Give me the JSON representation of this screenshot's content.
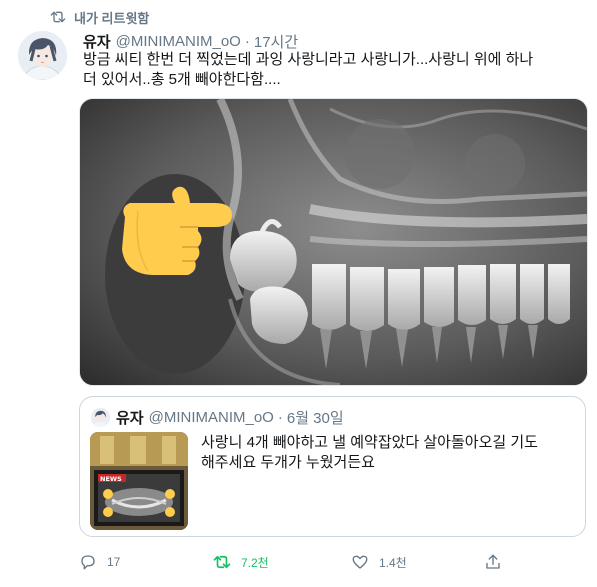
{
  "retweet_context": {
    "label": "내가 리트윗함",
    "icon": "retweet-icon"
  },
  "tweet": {
    "author_name": "유자",
    "author_handle": "@MINIMANIM_oO",
    "separator": "·",
    "time": "17시간",
    "text": "방금 씨티 한번 더 찍었는데 과잉 사랑니라고 사랑니가...사랑니 위에 하나\n더 있어서..총 5개 빼야한다함....",
    "media": {
      "type": "dental-xray",
      "overlay_icon": "pointing-hand-emoji"
    }
  },
  "quoted_tweet": {
    "author_name": "유자",
    "author_handle": "@MINIMANIM_oO",
    "separator": "·",
    "time": "6월 30일",
    "text": "사랑니 4개 빼야하고 낼 예약잡았다 살아돌아오길 기도\n해주세요 두개가 누웠거든요",
    "thumb_label": "NEWS"
  },
  "actions": {
    "reply": {
      "icon": "reply-icon",
      "count": "17"
    },
    "retweet": {
      "icon": "retweet-icon",
      "count": "7.2천",
      "active_color": "#17bf63"
    },
    "like": {
      "icon": "heart-icon",
      "count": "1.4천"
    },
    "share": {
      "icon": "share-icon"
    }
  }
}
